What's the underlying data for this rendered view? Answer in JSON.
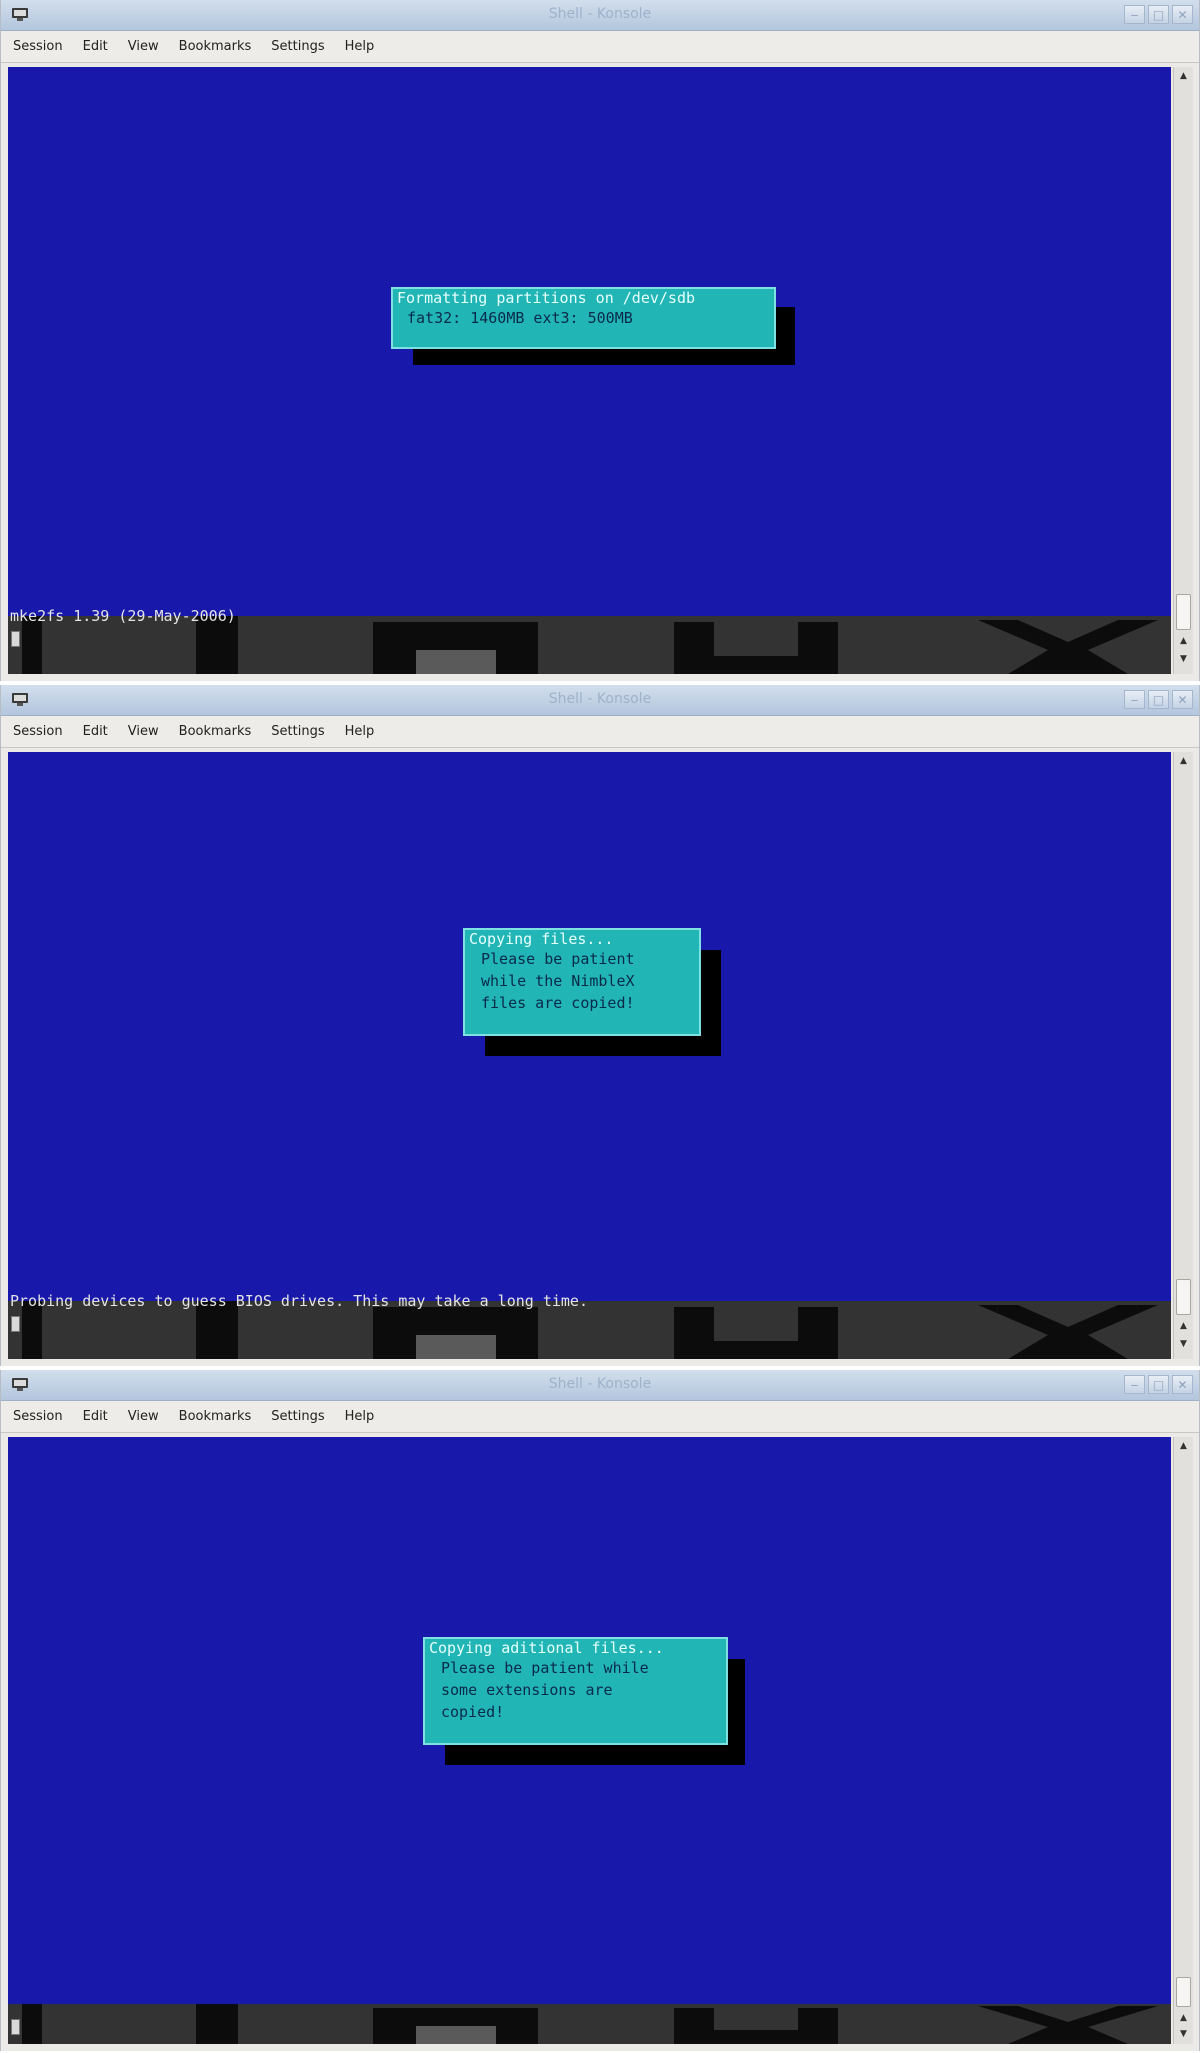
{
  "windows": [
    {
      "title": "Shell - Konsole",
      "menu": [
        "Session",
        "Edit",
        "View",
        "Bookmarks",
        "Settings",
        "Help"
      ],
      "dialog": {
        "title": "Formatting partitions on /dev/sdb",
        "lines": [
          "fat32: 1460MB ext3: 500MB"
        ]
      },
      "status_line": "mke2fs 1.39 (29-May-2006)"
    },
    {
      "title": "Shell - Konsole",
      "menu": [
        "Session",
        "Edit",
        "View",
        "Bookmarks",
        "Settings",
        "Help"
      ],
      "dialog": {
        "title": "Copying files...",
        "lines": [
          "Please be patient",
          "while the NimbleX",
          "files are copied!"
        ]
      },
      "status_line": "Probing devices to guess BIOS drives. This may take a long time."
    },
    {
      "title": "Shell - Konsole",
      "menu": [
        "Session",
        "Edit",
        "View",
        "Bookmarks",
        "Settings",
        "Help"
      ],
      "dialog": {
        "title": "Copying aditional files...",
        "lines": [
          "Please be patient while",
          "some extensions are",
          "copied!"
        ]
      },
      "status_line": ""
    }
  ],
  "colors": {
    "terminal_bg": "#1818aa",
    "dialog_bg": "#22b5b5",
    "dialog_border": "#7ee0e0"
  }
}
